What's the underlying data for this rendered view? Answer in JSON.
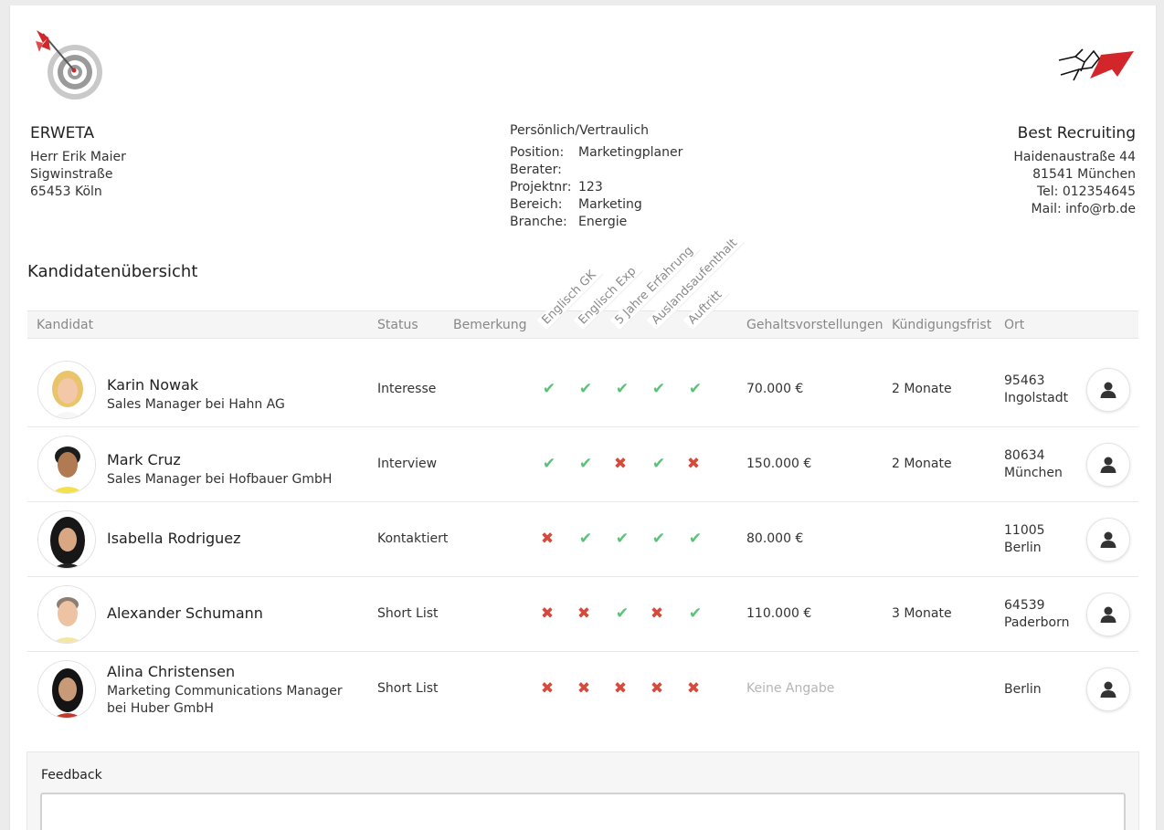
{
  "client": {
    "name": "ERWETA",
    "contact": "Herr Erik Maier",
    "street": "Sigwinstraße",
    "city": "65453 Köln"
  },
  "confidential": {
    "title": "Persönlich/Vertraulich",
    "fields": [
      {
        "label": "Position:",
        "value": "Marketingplaner"
      },
      {
        "label": "Berater:",
        "value": ""
      },
      {
        "label": "Projektnr:",
        "value": "123"
      },
      {
        "label": "Bereich:",
        "value": "Marketing"
      },
      {
        "label": "Branche:",
        "value": "Energie"
      }
    ]
  },
  "agency": {
    "name": "Best Recruiting",
    "street": "Haidenaustraße 44",
    "city": "81541 München",
    "tel": "Tel: 012354645",
    "mail": "Mail: info@rb.de"
  },
  "section_title": "Kandidatenübersicht",
  "table": {
    "headers": {
      "kandidat": "Kandidat",
      "status": "Status",
      "bemerkung": "Bemerkung",
      "gehalt": "Gehaltsvorstellungen",
      "kuendigung": "Kündigungsfrist",
      "ort": "Ort"
    },
    "criteria": [
      "Englisch GK",
      "Englisch Exp",
      "5 Jahre Erfahrung",
      "Auslandsaufenthalt",
      "Auftritt"
    ],
    "rows": [
      {
        "name": "Karin Nowak",
        "role": "Sales Manager bei Hahn AG",
        "status": "Interesse",
        "checks": [
          true,
          true,
          true,
          true,
          true
        ],
        "salary": "70.000 €",
        "notice": "2 Monate",
        "zip": "95463",
        "city": "Ingolstadt"
      },
      {
        "name": "Mark Cruz",
        "role": "Sales Manager bei Hofbauer GmbH",
        "status": "Interview",
        "checks": [
          true,
          true,
          false,
          true,
          false
        ],
        "salary": "150.000 €",
        "notice": "2 Monate",
        "zip": "80634",
        "city": "München"
      },
      {
        "name": "Isabella Rodriguez",
        "role": "",
        "status": "Kontaktiert",
        "checks": [
          false,
          true,
          true,
          true,
          true
        ],
        "salary": "80.000 €",
        "notice": "",
        "zip": "11005",
        "city": "Berlin"
      },
      {
        "name": "Alexander Schumann",
        "role": "",
        "status": "Short List",
        "checks": [
          false,
          false,
          true,
          false,
          true
        ],
        "salary": "110.000 €",
        "notice": "3 Monate",
        "zip": "64539",
        "city": "Paderborn"
      },
      {
        "name": "Alina Christensen",
        "role": "Marketing Communications Manager bei Huber GmbH",
        "status": "Short List",
        "checks": [
          false,
          false,
          false,
          false,
          false
        ],
        "salary": "Keine Angabe",
        "notice": "",
        "zip": "",
        "city": "Berlin"
      }
    ]
  },
  "feedback": {
    "title": "Feedback",
    "value": ""
  },
  "icons": {
    "client_logo": "target-dart-icon",
    "agency_logo": "red-arrow-logo-icon",
    "profile": "user-icon",
    "check": "check-icon",
    "cross": "cross-icon"
  },
  "colors": {
    "check": "#5cc27a",
    "cross": "#d64a3b",
    "logo_red": "#d3262b"
  }
}
